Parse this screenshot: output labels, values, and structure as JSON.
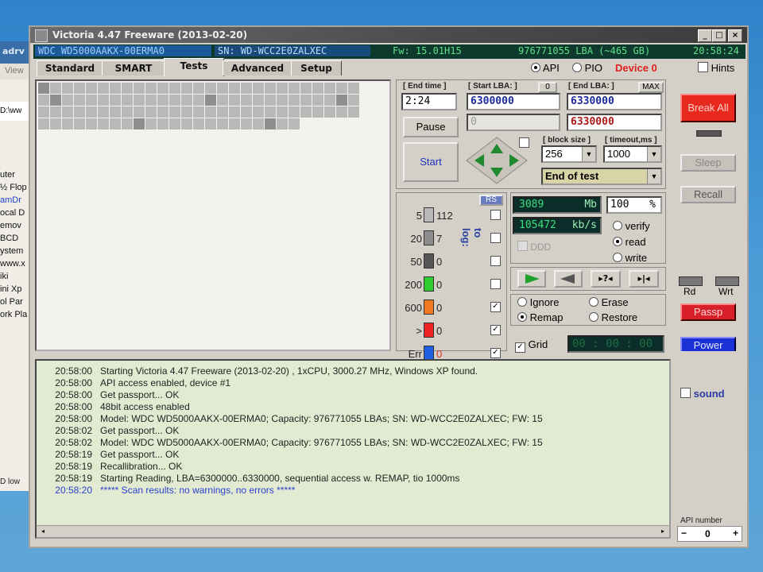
{
  "background_window": {
    "title_fragment": "adrv",
    "menu_fragment": "View",
    "address_fragment": "D:\\ww",
    "tree_items": [
      "uter",
      "½ Flop",
      "amDr",
      "ocal D",
      "emov",
      "BCD",
      "ystem",
      "www.x",
      "iki",
      "ini Xp",
      "ol Par",
      "ork Pla"
    ],
    "status_fragment": "D low"
  },
  "window": {
    "title": "Victoria 4.47  Freeware (2013-02-20)",
    "buttons": [
      "_",
      "□",
      "×"
    ]
  },
  "infobar": {
    "model": "WDC  WD5000AAKX-00ERMA0",
    "serial": "SN: WD-WCC2E0ZALXEC",
    "firmware": "Fw: 15.01H15",
    "lba": "976771055 LBA (~465 GB)",
    "clock": "20:58:24"
  },
  "tabs": [
    {
      "label": "Standard",
      "active": false
    },
    {
      "label": "SMART",
      "active": false
    },
    {
      "label": "Tests",
      "active": true
    },
    {
      "label": "Advanced",
      "active": false
    },
    {
      "label": "Setup",
      "active": false
    }
  ],
  "mode": {
    "api_label": "API",
    "pio_label": "PIO",
    "device_label": "Device 0",
    "hints_label": "Hints",
    "selected": "API"
  },
  "scan_map": {
    "rows": [
      "DLLLLLLLLLLLLLLLLLLLLLLLLLL",
      "LDLLLLLLLLLLLLDLLLLLLLLLLDL",
      "LLLLLLLLLLLLLLLLLLLLLLLLLLL",
      "LLLLLLLLDLLLLLLLLLLDLLEEEEE"
    ],
    "colors": {
      "light": "#b9b8b6",
      "dark": "#8f8e8c"
    }
  },
  "test_params": {
    "end_time_label": "[ End time ]",
    "end_time": "2:24",
    "start_lba_label": "[ Start LBA: ]",
    "start_lba_zero": "0",
    "start_lba": "6300000",
    "start_lba_current": "0",
    "end_lba_label": "[ End LBA: ]",
    "end_lba_max": "MAX",
    "end_lba": "6330000",
    "end_lba_current": "6330000",
    "pause_label": "Pause",
    "start_label": "Start",
    "block_size_label": "[ block size ]",
    "block_size": "256",
    "timeout_label": "[ timeout,ms ]",
    "timeout": "1000",
    "end_action": "End of test"
  },
  "legend": {
    "rs_label": "RS",
    "to_log_label": "to log:",
    "rows": [
      {
        "threshold": "5",
        "count": "112",
        "color": "#b8b8b8",
        "logged": false
      },
      {
        "threshold": "20",
        "count": "7",
        "color": "#8c8c8c",
        "logged": false
      },
      {
        "threshold": "50",
        "count": "0",
        "color": "#555555",
        "logged": false
      },
      {
        "threshold": "200",
        "count": "0",
        "color": "#2ecc2e",
        "logged": false
      },
      {
        "threshold": "600",
        "count": "0",
        "color": "#f07820",
        "logged": true
      },
      {
        "threshold": ">",
        "count": "0",
        "color": "#ee2222",
        "logged": true
      },
      {
        "threshold": "Err",
        "count": "0",
        "color": "#2060e0",
        "logged": true
      }
    ]
  },
  "progress": {
    "mb": "3089",
    "mb_unit": "Mb",
    "percent": "100",
    "percent_unit": "%",
    "speed": "105472",
    "speed_unit": "kb/s",
    "ddd_label": "DDD",
    "modes": [
      "verify",
      "read",
      "write"
    ],
    "selected_mode": "read"
  },
  "actions": {
    "options": [
      "Ignore",
      "Erase",
      "Remap",
      "Restore"
    ],
    "selected": "Remap",
    "grid_label": "Grid",
    "timer": "00 : 00 : 00"
  },
  "right_panel": {
    "break_all": "Break All",
    "sleep": "Sleep",
    "recall": "Recall",
    "rd": "Rd",
    "wrt": "Wrt",
    "passp": "Passp",
    "power": "Power",
    "sound": "sound",
    "api_number_label": "API number",
    "api_number": "0"
  },
  "log": [
    {
      "time": "20:58:00",
      "msg": "Starting Victoria 4.47  Freeware (2013-02-20) , 1xCPU, 3000.27 MHz, Windows XP found."
    },
    {
      "time": "20:58:00",
      "msg": "API access enabled, device #1"
    },
    {
      "time": "20:58:00",
      "msg": "Get passport... OK"
    },
    {
      "time": "20:58:00",
      "msg": "48bit access enabled"
    },
    {
      "time": "20:58:00",
      "msg": "Model: WDC WD5000AAKX-00ERMA0; Capacity: 976771055 LBAs; SN: WD-WCC2E0ZALXEC; FW: 15"
    },
    {
      "time": "20:58:02",
      "msg": "Get passport... OK"
    },
    {
      "time": "20:58:02",
      "msg": "Model: WDC WD5000AAKX-00ERMA0; Capacity: 976771055 LBAs; SN: WD-WCC2E0ZALXEC; FW: 15"
    },
    {
      "time": "20:58:19",
      "msg": "Get passport... OK"
    },
    {
      "time": "20:58:19",
      "msg": "Recallibration... OK"
    },
    {
      "time": "20:58:19",
      "msg": "Starting Reading, LBA=6300000..6330000, sequential access w. REMAP, tio 1000ms"
    },
    {
      "time": "20:58:20",
      "msg": "***** Scan results: no warnings, no errors *****"
    }
  ]
}
